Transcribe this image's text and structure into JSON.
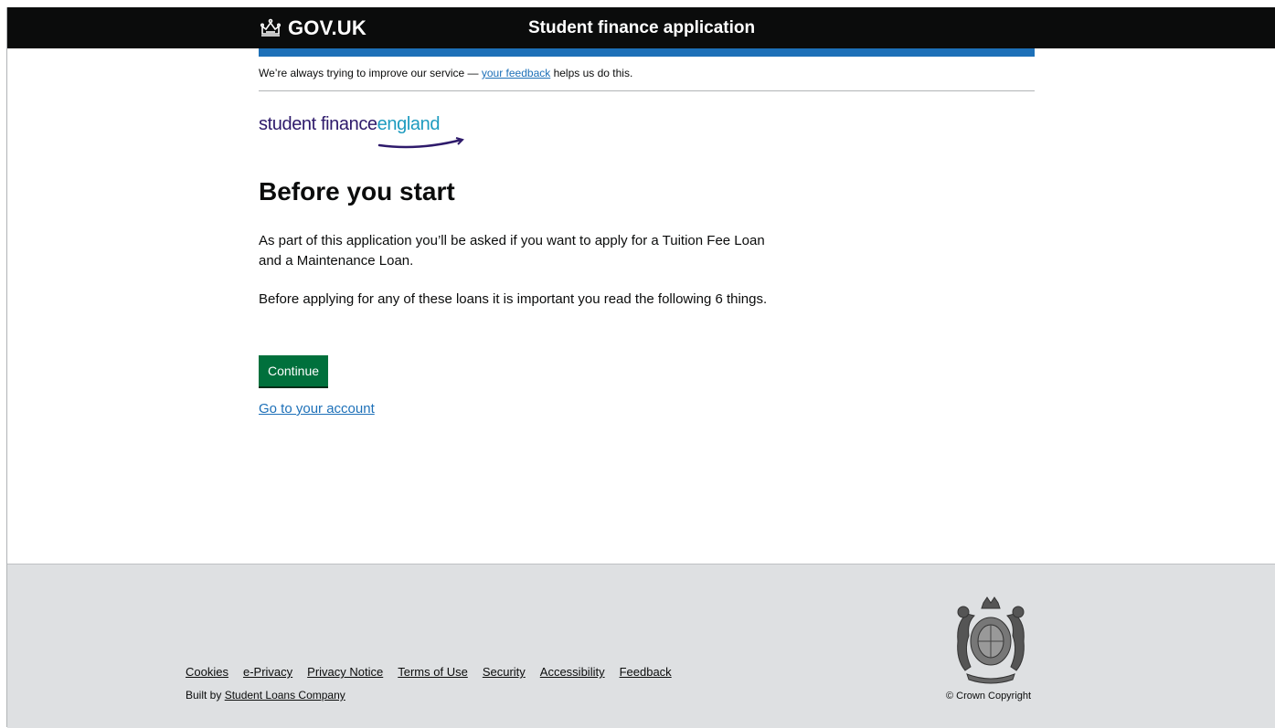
{
  "header": {
    "logo_text": "GOV.UK",
    "service_name": "Student finance application"
  },
  "phase_banner": {
    "text_before": "We’re always trying to improve our service — ",
    "link_text": "your feedback",
    "text_after": " helps us do this."
  },
  "brand": {
    "part1": "student finance",
    "part2": "england"
  },
  "main": {
    "title": "Before you start",
    "paragraph1": "As part of this application you’ll be asked if you want to apply for a Tuition Fee Loan and a Maintenance Loan.",
    "paragraph2": "Before applying for any of these loans it is important you read the following 6 things.",
    "continue_label": "Continue",
    "account_link": "Go to your account"
  },
  "footer": {
    "links": [
      "Cookies",
      "e-Privacy",
      "Privacy Notice",
      "Terms of Use",
      "Security",
      "Accessibility",
      "Feedback"
    ],
    "built_by_prefix": "Built by ",
    "built_by_link": "Student Loans Company",
    "copyright": "© Crown Copyright"
  },
  "colors": {
    "header_bg": "#0b0c0c",
    "accent_blue": "#1d70b8",
    "button_green": "#00703c",
    "footer_bg": "#dee0e2"
  }
}
